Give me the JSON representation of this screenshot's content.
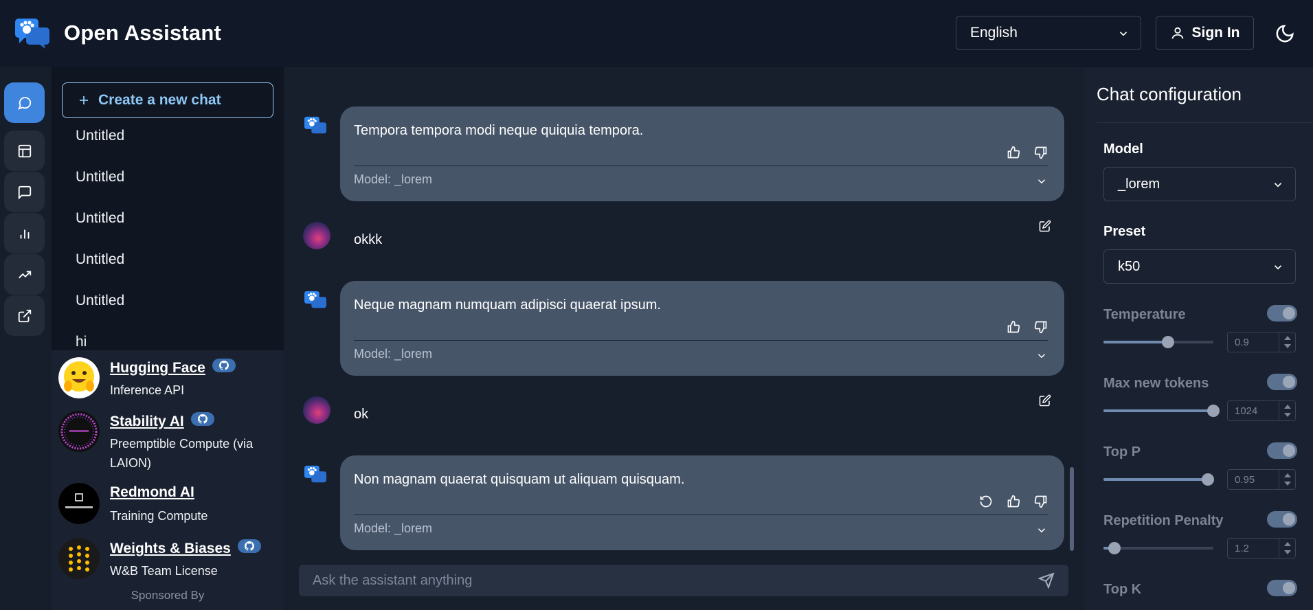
{
  "app": {
    "title": "Open Assistant"
  },
  "header": {
    "language": "English",
    "signin_label": "Sign In"
  },
  "sidebar": {
    "new_chat_label": "Create a new chat",
    "chats": [
      "Untitled",
      "Untitled",
      "Untitled",
      "Untitled",
      "Untitled",
      "hi"
    ]
  },
  "sponsors": {
    "items": [
      {
        "name": "Hugging Face",
        "desc": "Inference API"
      },
      {
        "name": "Stability AI",
        "desc": "Preemptible Compute (via LAION)"
      },
      {
        "name": "Redmond AI",
        "desc": "Training Compute"
      },
      {
        "name": "Weights & Biases",
        "desc": "W&B Team License"
      }
    ],
    "footer": "Sponsored By"
  },
  "messages": [
    {
      "role": "assistant",
      "text": "Tempora tempora modi neque quiquia tempora.",
      "model": "Model: _lorem"
    },
    {
      "role": "user",
      "text": "okkk"
    },
    {
      "role": "assistant",
      "text": "Neque magnam numquam adipisci quaerat ipsum.",
      "model": "Model: _lorem"
    },
    {
      "role": "user",
      "text": "ok"
    },
    {
      "role": "assistant",
      "text": "Non magnam quaerat quisquam ut aliquam quisquam.",
      "model": "Model: _lorem"
    }
  ],
  "input": {
    "placeholder": "Ask the assistant anything"
  },
  "config": {
    "title": "Chat configuration",
    "model_label": "Model",
    "model_value": "_lorem",
    "preset_label": "Preset",
    "preset_value": "k50",
    "params": [
      {
        "label": "Temperature",
        "value": "0.9",
        "slider_fraction": 0.59,
        "enabled": true
      },
      {
        "label": "Max new tokens",
        "value": "1024",
        "slider_fraction": 1.0,
        "enabled": true
      },
      {
        "label": "Top P",
        "value": "0.95",
        "slider_fraction": 0.95,
        "enabled": true
      },
      {
        "label": "Repetition Penalty",
        "value": "1.2",
        "slider_fraction": 0.1,
        "enabled": true
      },
      {
        "label": "Top K",
        "enabled": true
      }
    ]
  },
  "colors": {
    "accent": "#3f84dd",
    "bubble": "#475569",
    "link": "#8ec7f5"
  }
}
